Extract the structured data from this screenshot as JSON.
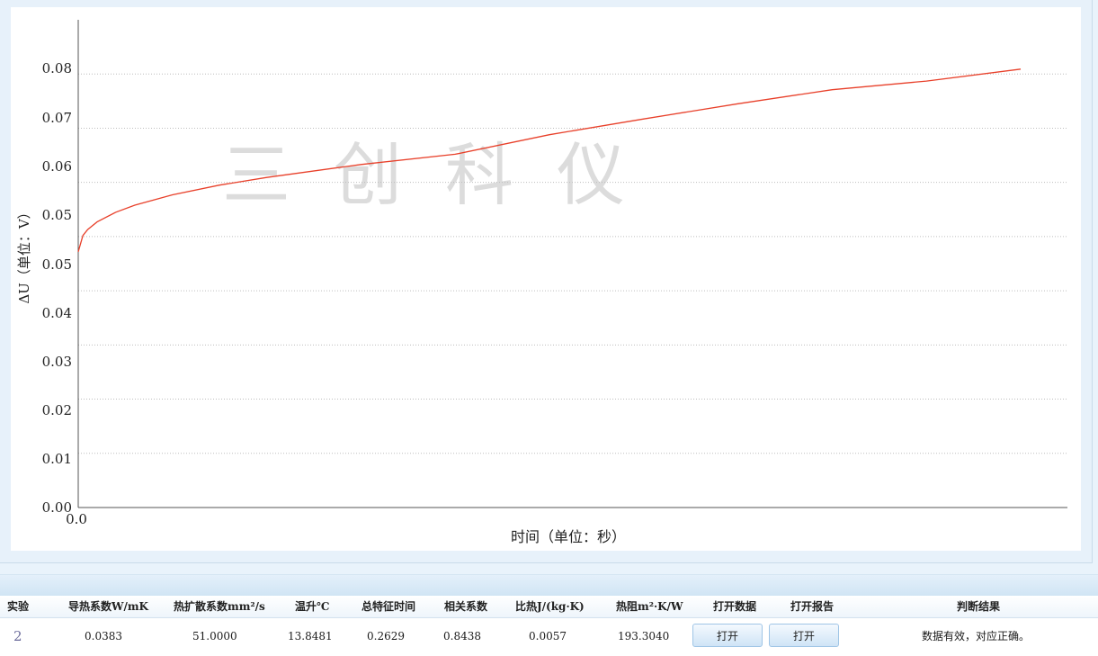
{
  "watermark": "三创科仪",
  "chart_data": {
    "type": "line",
    "ylabel": "ΔU（单位：V）",
    "xlabel": "时间（单位：秒）",
    "ylim": [
      0,
      0.09
    ],
    "y_tick_values": [
      0,
      0.01,
      0.02,
      0.03,
      0.04,
      0.05,
      0.06,
      0.07,
      0.08
    ],
    "y_tick_labels": [
      "0.00",
      "0.01",
      "0.02",
      "0.03",
      "0.04",
      "0.05",
      "0.05",
      "0.06",
      "0.07",
      "0.08"
    ],
    "x_tick_labels": [
      "0.0"
    ],
    "grid": true,
    "line_color": "#e8402a",
    "x": [
      0,
      0.005,
      0.01,
      0.02,
      0.04,
      0.06,
      0.1,
      0.15,
      0.2,
      0.3,
      0.4,
      0.5,
      0.6,
      0.7,
      0.8,
      0.9,
      1.0
    ],
    "y": [
      0.0472,
      0.0502,
      0.0513,
      0.0527,
      0.0545,
      0.0558,
      0.0577,
      0.0595,
      0.0609,
      0.0633,
      0.0652,
      0.0688,
      0.0717,
      0.0745,
      0.0771,
      0.0787,
      0.0809
    ]
  },
  "table": {
    "headers": [
      "实验",
      "导热系数W/mK",
      "热扩散系数mm²/s",
      "温升℃",
      "总特征时间",
      "相关系数",
      "比热J/(kg·K)",
      "热阻m²·K/W",
      "打开数据",
      "打开报告",
      "判断结果"
    ],
    "row": {
      "id": "2",
      "conductivity": "0.0383",
      "diffusivity": "51.0000",
      "temp_rise": "13.8481",
      "char_time": "0.2629",
      "correlation": "0.8438",
      "specific_heat": "0.0057",
      "thermal_resistance": "193.3040",
      "open_data_label": "打开",
      "open_report_label": "打开",
      "result": "数据有效，对应正确。"
    }
  }
}
